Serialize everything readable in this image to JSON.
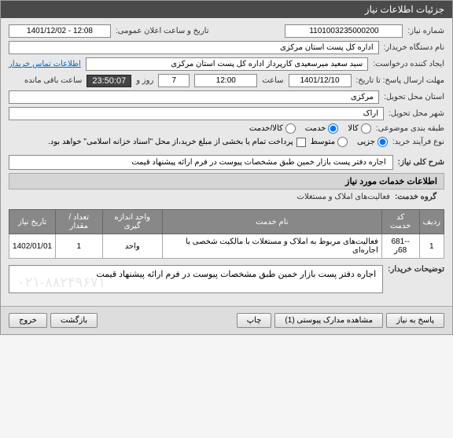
{
  "header": {
    "title": "جزئیات اطلاعات نیاز"
  },
  "fields": {
    "need_number_label": "شماره نیاز:",
    "need_number_value": "1101003235000200",
    "announce_date_label": "تاریخ و ساعت اعلان عمومی:",
    "announce_date_value": "1401/12/02 - 12:08",
    "buyer_org_label": "نام دستگاه خریدار:",
    "buyer_org_value": "اداره کل پست استان مرکزی",
    "creator_label": "ایجاد کننده درخواست:",
    "creator_value": "سید سعید میرسعیدی کارپرداز اداره کل پست استان مرکزی",
    "contact_link": "اطلاعات تماس خریدار",
    "deadline_label": "مهلت ارسال پاسخ: تا تاریخ:",
    "deadline_date": "1401/12/10",
    "time_label": "ساعت",
    "deadline_time": "12:00",
    "days_label": "روز و",
    "days_value": "7",
    "remaining_time": "23:50:07",
    "remaining_label": "ساعت باقی مانده",
    "delivery_province_label": "استان محل تحویل:",
    "delivery_province_value": "مرکزی",
    "delivery_city_label": "شهر محل تحویل:",
    "delivery_city_value": "اراک",
    "subject_type_label": "طبقه بندی موضوعی:",
    "subject_kala": "کالا",
    "subject_service": "خدمت",
    "subject_both": "کالا/خدمت",
    "purchase_type_label": "نوع فرآیند خرید:",
    "purchase_small": "جزیی",
    "purchase_medium": "متوسط",
    "purchase_note": "پرداخت تمام یا بخشی از مبلغ خرید،از محل \"اسناد خزانه اسلامی\" خواهد بود.",
    "need_title_label": "شرح کلی نیاز:",
    "need_title_value": "اجاره  دفتر پست بازار خمین طبق مشخصات پیوست در فرم ارائه پیشنهاد قیمت",
    "services_section": "اطلاعات خدمات مورد نیاز",
    "service_group_label": "گروه خدمت:",
    "service_group_value": "فعالیت‌های  املاک و مستغلات",
    "buyer_desc_label": "توضیحات خریدار:",
    "buyer_desc_value": "اجاره  دفتر پست بازار خمین طبق مشخصات پیوست در فرم ارائه پیشنهاد قیمت",
    "watermark": "۰۲۱-۸۸۲۴۹۶۷۱"
  },
  "table": {
    "headers": {
      "row": "ردیف",
      "code": "کد خدمت",
      "name": "نام خدمت",
      "unit": "واحد اندازه گیری",
      "qty": "تعداد / مقدار",
      "date": "تاریخ نیاز"
    },
    "rows": [
      {
        "row": "1",
        "code": "-681-68ر",
        "name": "فعالیت‌های مربوط به املاک و مستغلات با مالکیت شخصی یا اجاره‌ای",
        "unit": "واحد",
        "qty": "1",
        "date": "1402/01/01"
      }
    ]
  },
  "buttons": {
    "respond": "پاسخ به نیاز",
    "attachments": "مشاهده مدارک پیوستی (1)",
    "print": "چاپ",
    "back": "بازگشت",
    "exit": "خروج"
  }
}
